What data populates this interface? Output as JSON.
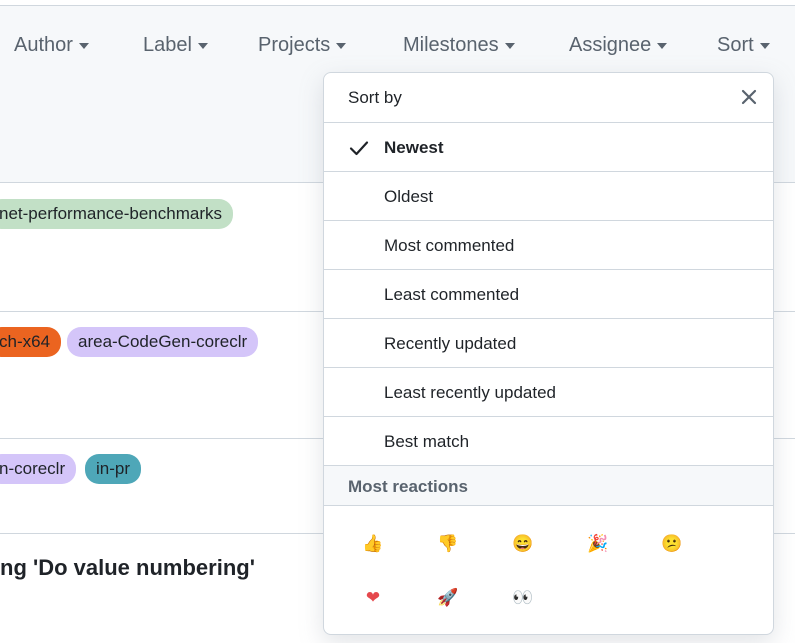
{
  "filters": [
    {
      "label": "Author"
    },
    {
      "label": "Label"
    },
    {
      "label": "Projects"
    },
    {
      "label": "Milestones"
    },
    {
      "label": "Assignee"
    },
    {
      "label": "Sort"
    }
  ],
  "issues": {
    "row1": {
      "labels": [
        {
          "text": "net-performance-benchmarks",
          "bg": "#c2e0c6",
          "fg": "#1f2328"
        }
      ]
    },
    "row2": {
      "labels": [
        {
          "text": "ch-x64",
          "bg": "#eb6420",
          "fg": "#1f2328"
        },
        {
          "text": "area-CodeGen-coreclr",
          "bg": "#d4c5f9",
          "fg": "#1f2328"
        }
      ]
    },
    "row3": {
      "labels": [
        {
          "text": "n-coreclr",
          "bg": "#d4c5f9",
          "fg": "#1f2328"
        },
        {
          "text": "in-pr",
          "bg": "#4ea7b8",
          "fg": "#1f2328"
        }
      ]
    },
    "row4": {
      "title": "ng 'Do value numbering'"
    }
  },
  "sort_menu": {
    "title": "Sort by",
    "items": [
      {
        "label": "Newest",
        "selected": true
      },
      {
        "label": "Oldest"
      },
      {
        "label": "Most commented"
      },
      {
        "label": "Least commented"
      },
      {
        "label": "Recently updated"
      },
      {
        "label": "Least recently updated"
      },
      {
        "label": "Best match"
      }
    ],
    "reactions_title": "Most reactions",
    "reactions": [
      {
        "name": "thumbs-up-icon",
        "glyph": "👍"
      },
      {
        "name": "thumbs-down-icon",
        "glyph": "👎"
      },
      {
        "name": "laugh-icon",
        "glyph": "😄"
      },
      {
        "name": "hooray-icon",
        "glyph": "🎉"
      },
      {
        "name": "confused-icon",
        "glyph": "😕"
      },
      {
        "name": "heart-icon",
        "glyph": "❤"
      },
      {
        "name": "rocket-icon",
        "glyph": "🚀"
      },
      {
        "name": "eyes-icon",
        "glyph": "👀"
      }
    ]
  },
  "colors": {
    "accent": "#0969da",
    "border": "#d0d7de",
    "muted": "#59636e"
  }
}
